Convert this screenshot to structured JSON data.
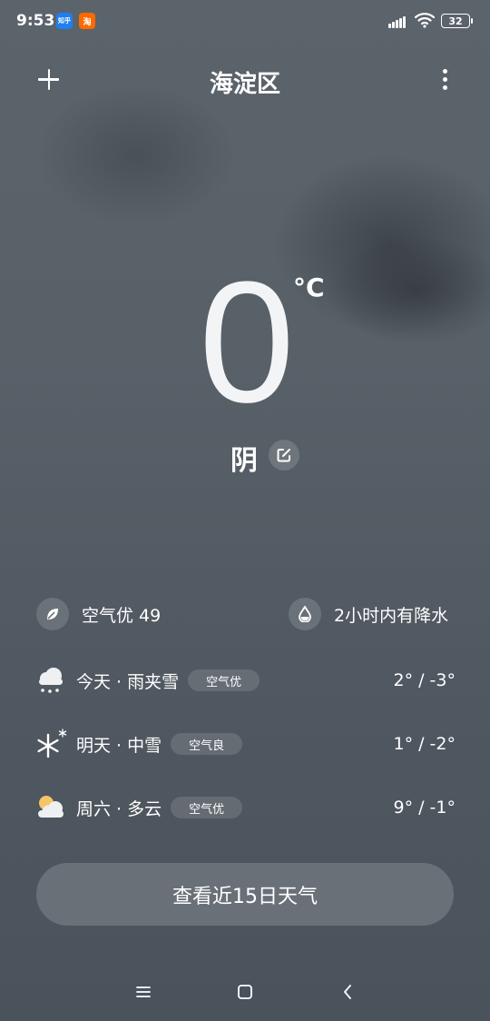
{
  "status_bar": {
    "time": "9:53",
    "badges": [
      "知乎",
      "淘"
    ],
    "battery": "32"
  },
  "header": {
    "city": "海淀区"
  },
  "current": {
    "temperature": "0",
    "unit": "°C",
    "condition": "阴"
  },
  "info": {
    "air_quality": "空气优 49",
    "precipitation": "2小时内有降水"
  },
  "forecast": [
    {
      "label": "今天 · 雨夹雪",
      "air": "空气优",
      "range": "2° / -3°",
      "icon": "sleet-icon"
    },
    {
      "label": "明天 · 中雪",
      "air": "空气良",
      "range": "1° / -2°",
      "icon": "snow-icon"
    },
    {
      "label": "周六 · 多云",
      "air": "空气优",
      "range": "9° / -1°",
      "icon": "partly-cloudy-icon"
    }
  ],
  "cta_label": "查看近15日天气"
}
